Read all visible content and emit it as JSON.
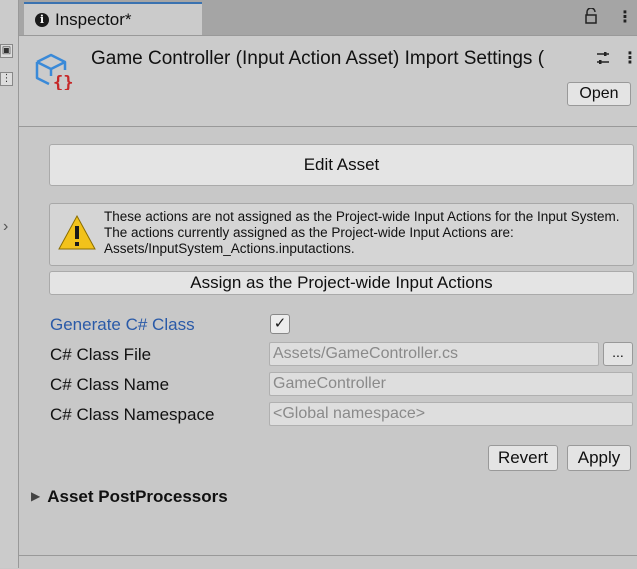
{
  "tab": {
    "label": "Inspector*"
  },
  "header": {
    "title": "Game Controller (Input Action Asset) Import Settings (",
    "open_label": "Open"
  },
  "main": {
    "edit_asset_label": "Edit Asset",
    "warning_text": "These actions are not assigned as the Project-wide Input Actions for the Input System.  The actions currently assigned as the Project-wide Input Actions are: Assets/InputSystem_Actions.inputactions.",
    "assign_label": "Assign as the Project-wide Input Actions",
    "generate_label": "Generate C# Class",
    "generate_checked": true,
    "class_file_label": "C# Class File",
    "class_file_value": "Assets/GameController.cs",
    "browse_label": "...",
    "class_name_label": "C# Class Name",
    "class_name_placeholder": "GameController",
    "namespace_label": "C# Class Namespace",
    "namespace_placeholder": "<Global namespace>",
    "revert_label": "Revert",
    "apply_label": "Apply",
    "postprocessors_label": "Asset PostProcessors"
  },
  "colors": {
    "accent_blue": "#2a5aa8",
    "warning_yellow": "#f2c21b",
    "asset_icon_blue": "#3a8ad8",
    "asset_icon_red": "#c62828"
  }
}
